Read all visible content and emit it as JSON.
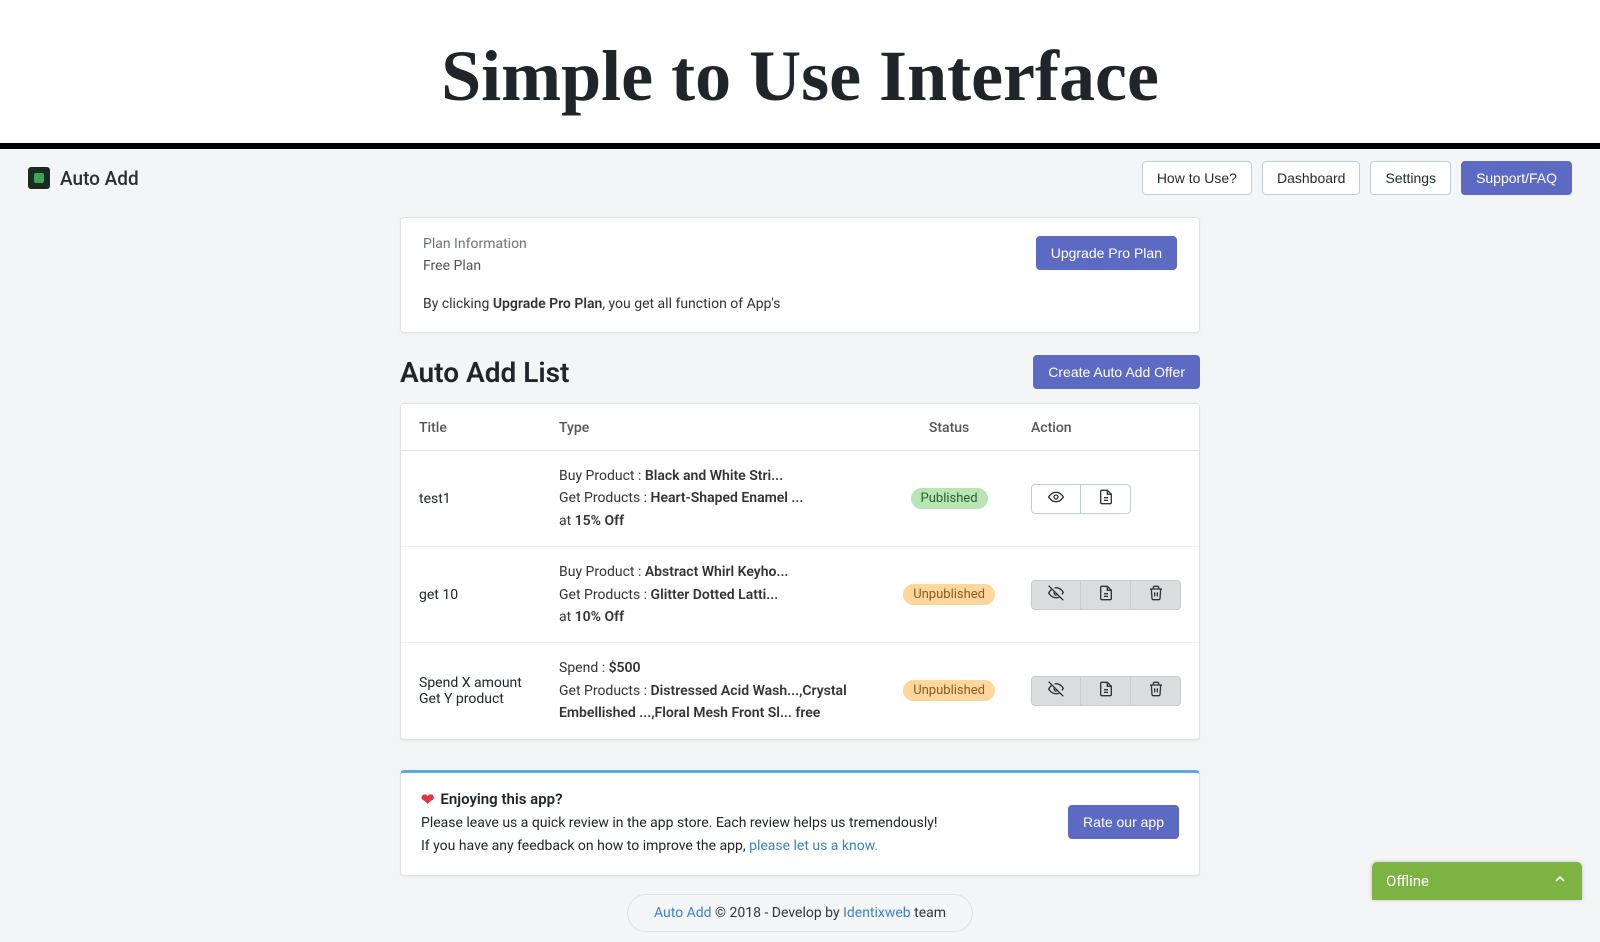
{
  "marketing": {
    "title": "Simple to Use Interface"
  },
  "header": {
    "app_name": "Auto Add",
    "nav": {
      "how": "How to Use?",
      "dashboard": "Dashboard",
      "settings": "Settings",
      "support": "Support/FAQ"
    }
  },
  "plan": {
    "label": "Plan Information",
    "name": "Free Plan",
    "upgrade_btn": "Upgrade Pro Plan",
    "note_pre": "By clicking ",
    "note_strong": "Upgrade Pro Plan",
    "note_post": ", you get all function of App's"
  },
  "list": {
    "title": "Auto Add List",
    "create_btn": "Create Auto Add Offer",
    "columns": {
      "title": "Title",
      "type": "Type",
      "status": "Status",
      "action": "Action"
    },
    "rows": [
      {
        "title": "test1",
        "type": {
          "l1a": "Buy Product : ",
          "l1b": "Black and White Stri...",
          "l2a": "Get Products : ",
          "l2b": "Heart-Shaped Enamel ...",
          "l3a": "at ",
          "l3b": "15% Off"
        },
        "status": "Published",
        "status_class": "published",
        "actions_gray": false,
        "show_delete": false
      },
      {
        "title": "get 10",
        "type": {
          "l1a": "Buy Product : ",
          "l1b": "Abstract Whirl Keyho...",
          "l2a": "Get Products : ",
          "l2b": "Glitter Dotted Latti...",
          "l3a": "at ",
          "l3b": "10% Off"
        },
        "status": "Unpublished",
        "status_class": "unpublished",
        "actions_gray": true,
        "show_delete": true
      },
      {
        "title": "Spend X amount Get Y product",
        "type": {
          "l1a": "Spend : ",
          "l1b": "$500",
          "l2a": "Get Products : ",
          "l2b": "Distressed Acid Wash...,Crystal Embellished ...,Floral Mesh Front Sl... free",
          "l3a": "",
          "l3b": ""
        },
        "status": "Unpublished",
        "status_class": "unpublished",
        "actions_gray": true,
        "show_delete": true
      }
    ]
  },
  "enjoy": {
    "title": "Enjoying this app?",
    "line1": "Please leave us a quick review in the app store. Each review helps us tremendously!",
    "line2_pre": "If you have any feedback on how to improve the app, ",
    "line2_link": "please let us a know.",
    "rate_btn": "Rate our app"
  },
  "footer": {
    "app_link": "Auto Add",
    "mid": " © 2018 - Develop by ",
    "dev_link": "Identixweb",
    "tail": " team"
  },
  "chat": {
    "status": "Offline"
  },
  "icons": {
    "eye": "eye-icon",
    "eye_off": "eye-off-icon",
    "document": "document-icon",
    "trash": "trash-icon",
    "heart": "heart-icon",
    "chevron_up": "chevron-up-icon"
  }
}
